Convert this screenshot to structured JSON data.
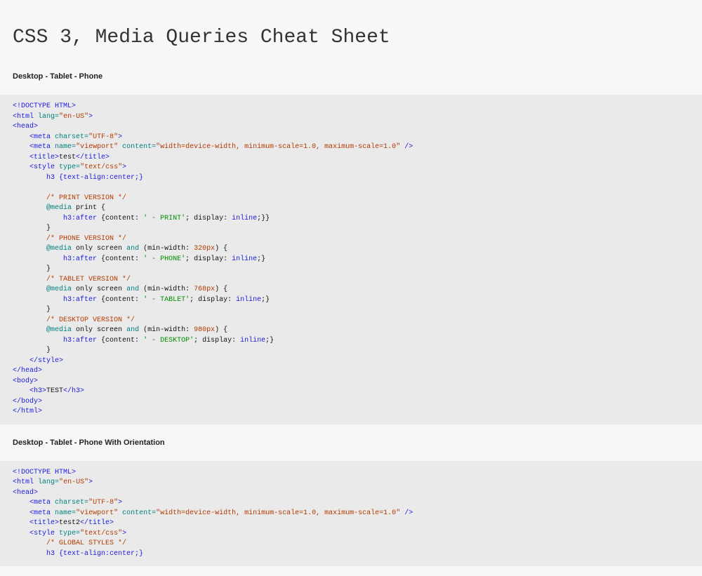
{
  "title": "CSS 3, Media Queries Cheat Sheet",
  "sections": [
    {
      "label": "Desktop - Tablet - Phone",
      "code": {
        "lang": "en-US",
        "charset": "UTF-8",
        "viewport": "width=device-width, minimum-scale=1.0, maximum-scale=1.0",
        "title": "test",
        "styleType": "text/css",
        "baseRule": "h3 {text-align:center;}",
        "groups": [
          {
            "cmt": "/* PRINT VERSION */",
            "media": "@media print {",
            "rule": "h3:after {content: ' - PRINT'; display: inline;}}"
          },
          {
            "cmt": "/* PHONE VERSION */",
            "media": "@media only screen and (min-width: 320px) {",
            "rule": "h3:after {content: ' - PHONE'; display: inline;}"
          },
          {
            "cmt": "/* TABLET VERSION */",
            "media": "@media only screen and (min-width: 768px) {",
            "rule": "h3:after {content: ' - TABLET'; display: inline;}"
          },
          {
            "cmt": "/* DESKTOP VERSION */",
            "media": "@media only screen and (min-width: 980px) {",
            "rule": "h3:after {content: ' - DESKTOP'; display: inline;}"
          }
        ],
        "bodyText": "TEST"
      }
    },
    {
      "label": "Desktop - Tablet - Phone With Orientation",
      "code": {
        "lang": "en-US",
        "charset": "UTF-8",
        "viewport": "width=device-width, minimum-scale=1.0, maximum-scale=1.0",
        "title": "test2",
        "styleType": "text/css",
        "globalCmt": "/* GLOBAL STYLES */",
        "baseRule": "h3 {text-align:center;}"
      }
    }
  ]
}
